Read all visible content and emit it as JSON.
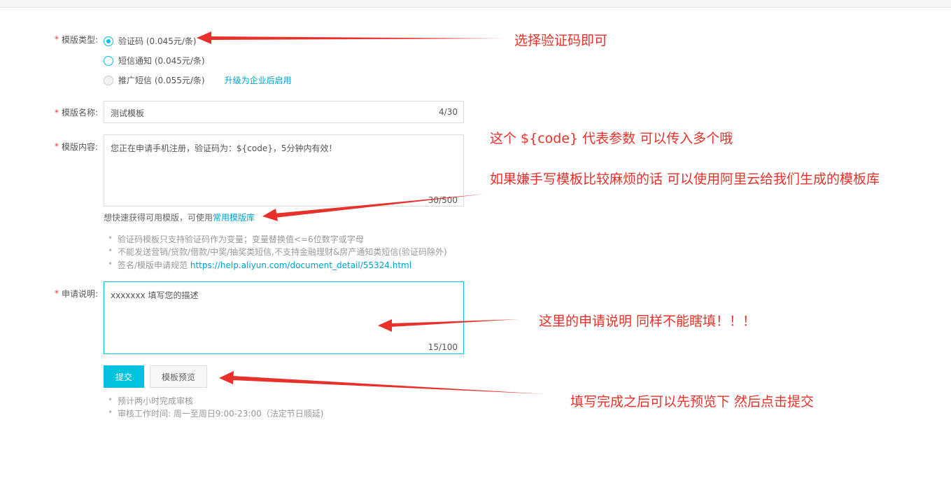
{
  "form": {
    "template_type": {
      "label": "模版类型:",
      "options": [
        {
          "label": "验证码 (0.045元/条)",
          "checked": true
        },
        {
          "label": "短信通知 (0.045元/条)",
          "checked": false
        },
        {
          "label": "推广短信 (0.055元/条)",
          "checked": false,
          "disabled": true
        }
      ],
      "upgrade_link": "升级为企业后启用"
    },
    "template_name": {
      "label": "模版名称:",
      "value": "测试模板",
      "counter": "4/30"
    },
    "template_content": {
      "label": "模版内容:",
      "value": "您正在申请手机注册，验证码为：${code}，5分钟内有效！",
      "counter": "30/500",
      "hint_prefix": "想快速获得可用模版，可使用",
      "hint_link": "常用模版库"
    },
    "rules": [
      {
        "text": "验证码模板只支持验证码作为变量；变量替换值<=6位数字或字母"
      },
      {
        "text": "不能发送营销/贷款/借款/中奖/抽奖类短信,不支持金融理财&房产通知类短信(验证码除外)"
      },
      {
        "text": "签名/模版申请规范 ",
        "link": "https://help.aliyun.com/document_detail/55324.html"
      }
    ],
    "application_note": {
      "label": "申请说明:",
      "value": "xxxxxxx  填写您的描述",
      "counter": "15/100"
    },
    "buttons": {
      "submit": "提交",
      "preview": "模板预览"
    },
    "review_notes": [
      "预计两小时完成审核",
      "审核工作时间: 周一至周日9:00-23:00（法定节日顺延)"
    ]
  },
  "annotations": {
    "a1": "选择验证码即可",
    "a2": "这个 ${code} 代表参数 可以传入多个哦",
    "a3": "如果嫌手写模板比较麻烦的话 可以使用阿里云给我们生成的模板库",
    "a4": "这里的申请说明 同样不能瞎填！！！",
    "a5": "填写完成之后可以先预览下 然后点击提交"
  },
  "colors": {
    "accent": "#00c1de",
    "link": "#00a2ca",
    "required": "#e4393c",
    "annotation": "#e8312a"
  }
}
